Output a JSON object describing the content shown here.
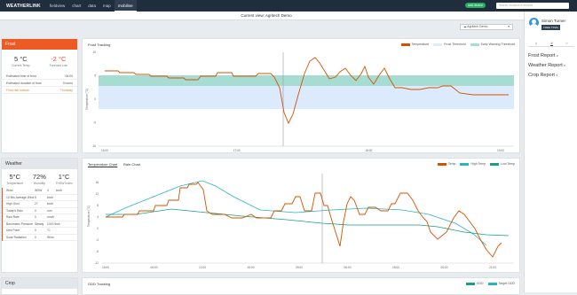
{
  "topbar": {
    "logo": "WEATHERLINK",
    "nav": [
      "fieldview",
      "chart",
      "data",
      "map",
      "mobiline"
    ],
    "active_index": 4,
    "demo_badge": "add device",
    "search_placeholder": "Search locations & devices"
  },
  "subheader": {
    "title": "Current view: Agritech Demo"
  },
  "site_select": {
    "value": "Agritech Demo"
  },
  "frost": {
    "header": "Frost",
    "current_temp": "5 °C",
    "current_temp_label": "Current Temp",
    "forecast_low": "-2 °C",
    "forecast_low_label": "Forecast Low",
    "rows": [
      {
        "k": "Estimated time of frost",
        "v": "06:00"
      },
      {
        "k": "Estimated duration of frost",
        "v": "3 hours"
      },
      {
        "k": "Frost risk outlook",
        "v": "Thursday"
      }
    ]
  },
  "weather": {
    "header": "Weather",
    "temp": "5°C",
    "temp_label": "Temperature",
    "humidity": "72%",
    "humidity_label": "Humidity",
    "thi": "1°C",
    "thi_label": "THSW Index",
    "rows": [
      {
        "a": "Wind",
        "b": "WSW",
        "c": "4",
        "d": "km/h"
      },
      {
        "a": "10 Min Average Wind",
        "b": "5",
        "c": "km/h",
        "d": ""
      },
      {
        "a": "High Gust",
        "b": "27",
        "c": "km/h",
        "d": ""
      },
      {
        "a": "Today's Rain",
        "b": "0",
        "c": "mm",
        "d": ""
      },
      {
        "a": "Rain Rate",
        "b": "0",
        "c": "mm/h",
        "d": ""
      },
      {
        "a": "Barometric Pressure",
        "b": "Steady",
        "c": "1019.5",
        "d": "mb"
      },
      {
        "a": "Dew Point",
        "b": "0",
        "c": "°C",
        "d": ""
      },
      {
        "a": "Solar Radiation",
        "b": "0",
        "c": "W/m²",
        "d": ""
      }
    ]
  },
  "crop": {
    "header": "Crop"
  },
  "frost_chart": {
    "title": "Frost Tracking",
    "legend": [
      "Temperature",
      "Frost Threshold",
      "Early Warning Threshold"
    ],
    "ylabel": "Temperature (°C)",
    "yticks": [
      "10",
      "5",
      "0",
      "-5",
      "-10"
    ],
    "xticks": [
      "16:00",
      "17:00",
      "18:00",
      "19:00"
    ]
  },
  "temp_chart": {
    "tab1": "Temperature Chart",
    "tab2": "Rain Chart",
    "legend": [
      "Temp",
      "High Temp",
      "Low Temp"
    ],
    "ylabel": "Temperature (°C)",
    "yticks": [
      "16",
      "12",
      "8",
      "4",
      "0",
      "-4",
      "-8",
      "-12"
    ],
    "xticks": [
      "18:00",
      "06:00",
      "12:00",
      "15:00",
      "09:00",
      "06:00",
      "18:00",
      "06:00",
      "21:00"
    ]
  },
  "gdd_chart": {
    "title": "GDD Tracking",
    "legend": [
      "GDD",
      "Target GDD"
    ]
  },
  "colors": {
    "temp": "#d35400",
    "high": "#2ab3c0",
    "low": "#16a085",
    "frost_band": "#dbeafc",
    "warn_band": "#a6dcd2",
    "accent": "#ee5a24"
  },
  "user": {
    "name": "Simon Turner",
    "badge": "FREE TRIAL"
  },
  "right_tabs": [
    "☼",
    "#",
    "○"
  ],
  "reports": [
    "Frost Report",
    "Weather Report",
    "Crop Report"
  ]
}
